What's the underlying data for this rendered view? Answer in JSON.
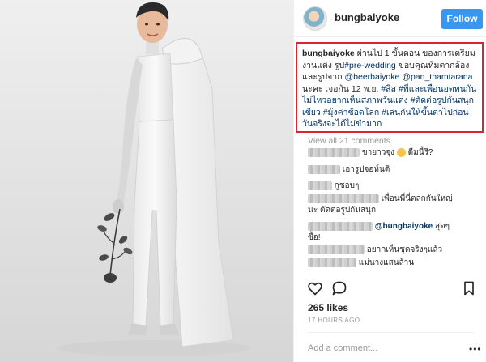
{
  "post": {
    "username": "bungbaiyoke",
    "follow_label": "Follow",
    "caption": {
      "username": "bungbaiyoke",
      "text_1": "ผ่านไป 1 ขั้นตอน ของการเตรียมงานแต่ง รูป",
      "tag_1": "#pre-wedding",
      "text_2": " ขอบคุณทีมตากล้อง และรูปจาก ",
      "mention_1": "@beerbaiyoke",
      "text_3": " ",
      "mention_2": "@pan_thamtarana",
      "text_4": " นะคะ เจอกัน 12 พ.ย. ",
      "tag_2": "#สีส",
      "tag_3": "#พี่และเพื่อนอดทนกันไม่ไหวอยากเห็นสภาพวันแต่ง",
      "tag_4": "#ตัดต่อรูปกันสนุกเชียว",
      "tag_5": "#มุ้งค่าช้อดโลก",
      "tag_6": "#เล่นกันให้ขึ้นตาไปก่อนวันจริงจะได้ไม่ขำมาก"
    },
    "view_all": "View all 21 comments",
    "comments": [
      {
        "text": "ขายาวจุง",
        "suffix": " ดีมนี้รึ?"
      },
      {
        "text": "เอารูปจอห์นดิ"
      },
      {
        "text": "กูชอบๆ"
      },
      {
        "text": "เพื่อนพี่นี่ตลกกันใหญ่",
        "cont": "นะ ตัดต่อรูปกันสนุก"
      },
      {
        "mention": "@bungbaiyoke",
        "text": " สุดๆ",
        "cont": "ซื้อ!"
      },
      {
        "text": "อยากเห็นชุดจริงๆแล้ว"
      },
      {
        "text": "แม่นางแสนล้าน"
      }
    ],
    "likes": "265 likes",
    "time": "17 HOURS AGO",
    "add_comment_placeholder": "Add a comment...",
    "more_label": "•••"
  },
  "icons": {
    "heart": "heart-icon",
    "comment": "comment-icon",
    "bookmark": "bookmark-icon",
    "more": "more-options-icon"
  },
  "colors": {
    "follow_button": "#3897f0",
    "highlight_border": "#d9232d",
    "link": "#003569",
    "meta_text": "#999999"
  }
}
